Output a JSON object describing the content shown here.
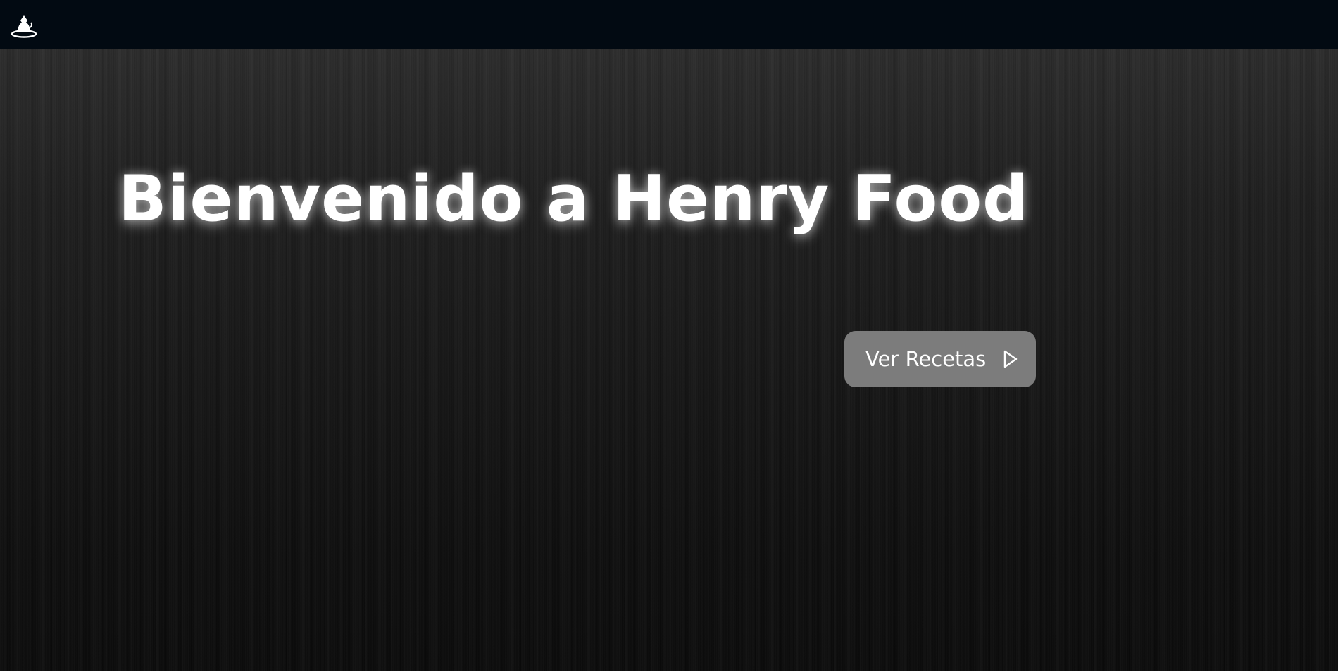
{
  "navbar": {
    "logo_icon": "chef-icon",
    "background": "#020a12"
  },
  "hero": {
    "title": "Bienvenido a Henry Food",
    "cta_label": "Ver Recetas",
    "cta_icon": "play-outline-icon",
    "cta_color": "#7c7c7c"
  }
}
